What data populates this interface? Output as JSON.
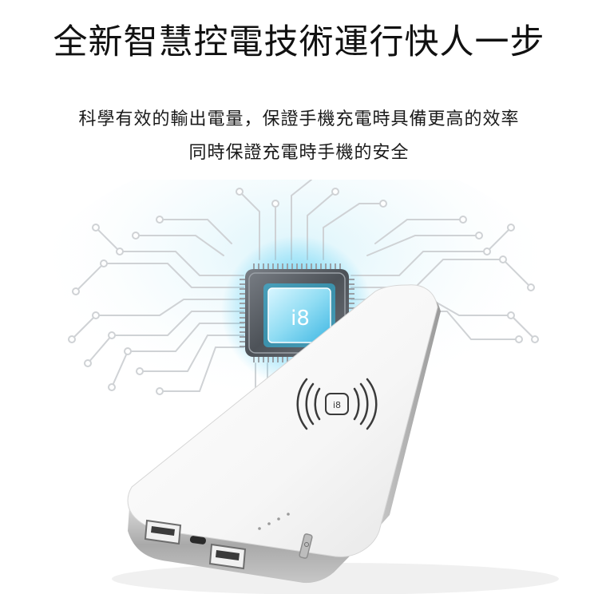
{
  "headline": "全新智慧控電技術運行快人一步",
  "subtitle": {
    "line1": "科學有效的輸出電量，保證手機充電時具備更高的效率",
    "line2": "同時保證充電時手機的安全"
  },
  "chip": {
    "label": "i8"
  },
  "power_bank": {
    "wireless_logo": "i8",
    "indicator_lights": 4,
    "ports": [
      "usb-port",
      "micro-usb-port",
      "usb-port"
    ]
  },
  "colors": {
    "chip_glow": "#2ec4f0",
    "chip_face": "#9fe4f7",
    "power_bank_body": "#f4f4f4",
    "power_bank_trim": "#b5b5b5",
    "circuit_lines": "#d4d6d8"
  }
}
